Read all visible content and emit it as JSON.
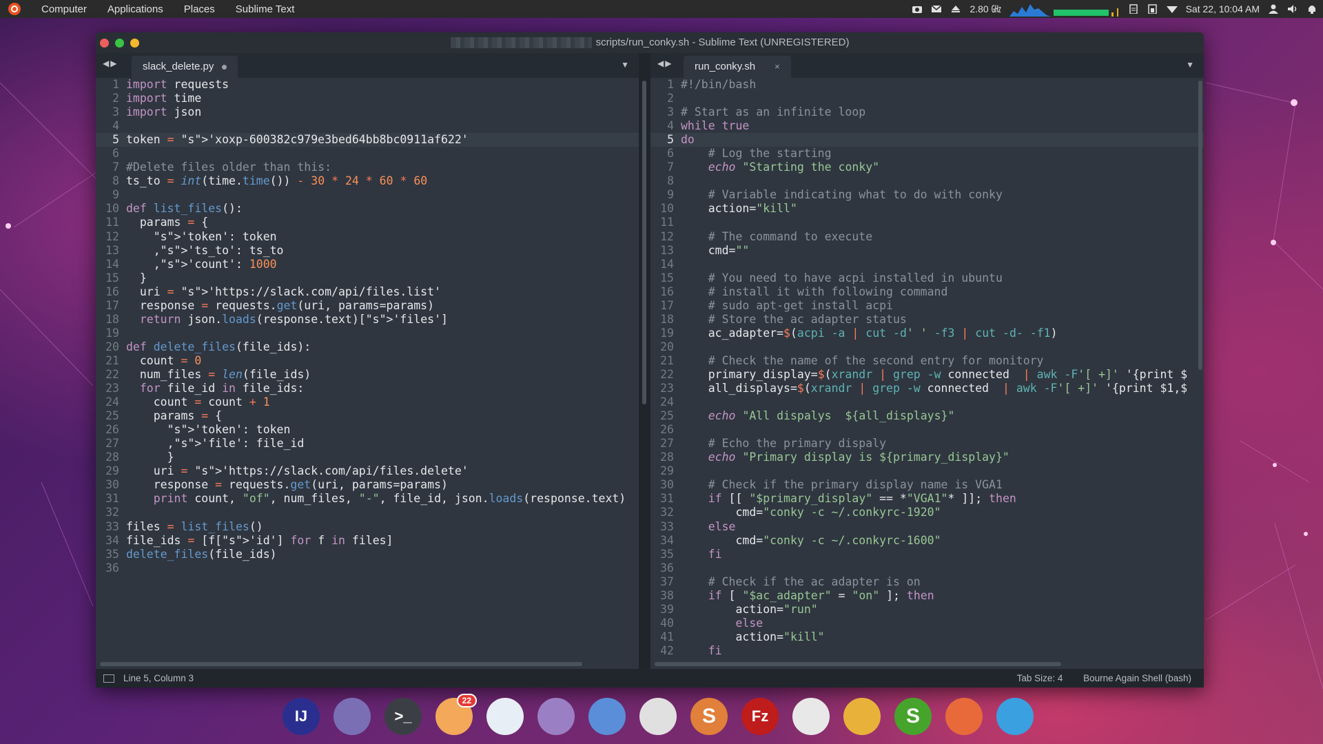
{
  "topbar": {
    "menus": [
      "Computer",
      "Applications",
      "Places",
      "Sublime Text"
    ],
    "cpu_freq": "2.80 ㎓",
    "datetime": "Sat 22, 10:04 AM"
  },
  "window": {
    "title": "scripts/run_conky.sh - Sublime Text (UNREGISTERED)"
  },
  "left_pane": {
    "tab_label": "slack_delete.py",
    "lines": [
      [
        "1",
        "import requests"
      ],
      [
        "2",
        "import time"
      ],
      [
        "3",
        "import json"
      ],
      [
        "4",
        ""
      ],
      [
        "5",
        "token = 'xoxp-600382c979e3bed64bb8bc0911af622'"
      ],
      [
        "6",
        ""
      ],
      [
        "7",
        "#Delete files older than this:"
      ],
      [
        "8",
        "ts_to = int(time.time()) - 30 * 24 * 60 * 60"
      ],
      [
        "9",
        ""
      ],
      [
        "10",
        "def list_files():"
      ],
      [
        "11",
        "  params = {"
      ],
      [
        "12",
        "    'token': token"
      ],
      [
        "13",
        "    ,'ts_to': ts_to"
      ],
      [
        "14",
        "    ,'count': 1000"
      ],
      [
        "15",
        "  }"
      ],
      [
        "16",
        "  uri = 'https://slack.com/api/files.list'"
      ],
      [
        "17",
        "  response = requests.get(uri, params=params)"
      ],
      [
        "18",
        "  return json.loads(response.text)['files']"
      ],
      [
        "19",
        ""
      ],
      [
        "20",
        "def delete_files(file_ids):"
      ],
      [
        "21",
        "  count = 0"
      ],
      [
        "22",
        "  num_files = len(file_ids)"
      ],
      [
        "23",
        "  for file_id in file_ids:"
      ],
      [
        "24",
        "    count = count + 1"
      ],
      [
        "25",
        "    params = {"
      ],
      [
        "26",
        "      'token': token"
      ],
      [
        "27",
        "      ,'file': file_id"
      ],
      [
        "28",
        "      }"
      ],
      [
        "29",
        "    uri = 'https://slack.com/api/files.delete'"
      ],
      [
        "30",
        "    response = requests.get(uri, params=params)"
      ],
      [
        "31",
        "    print count, \"of\", num_files, \"-\", file_id, json.loads(response.text)"
      ],
      [
        "32",
        ""
      ],
      [
        "33",
        "files = list_files()"
      ],
      [
        "34",
        "file_ids = [f['id'] for f in files]"
      ],
      [
        "35",
        "delete_files(file_ids)"
      ],
      [
        "36",
        ""
      ]
    ]
  },
  "right_pane": {
    "tab_label": "run_conky.sh",
    "tab_close": "×",
    "lines": [
      [
        "1",
        "#!/bin/bash"
      ],
      [
        "2",
        ""
      ],
      [
        "3",
        "# Start as an infinite loop"
      ],
      [
        "4",
        "while true"
      ],
      [
        "5",
        "do"
      ],
      [
        "6",
        "    # Log the starting"
      ],
      [
        "7",
        "    echo \"Starting the conky\""
      ],
      [
        "8",
        ""
      ],
      [
        "9",
        "    # Variable indicating what to do with conky"
      ],
      [
        "10",
        "    action=\"kill\""
      ],
      [
        "11",
        ""
      ],
      [
        "12",
        "    # The command to execute"
      ],
      [
        "13",
        "    cmd=\"\""
      ],
      [
        "14",
        ""
      ],
      [
        "15",
        "    # You need to have acpi installed in ubuntu"
      ],
      [
        "16",
        "    # install it with following command"
      ],
      [
        "17",
        "    # sudo apt-get install acpi"
      ],
      [
        "18",
        "    # Store the ac adapter status"
      ],
      [
        "19",
        "    ac_adapter=$(acpi -a | cut -d' ' -f3 | cut -d- -f1)"
      ],
      [
        "20",
        ""
      ],
      [
        "21",
        "    # Check the name of the second entry for monitory"
      ],
      [
        "22",
        "    primary_display=$(xrandr | grep -w connected  | awk -F'[ +]' '{print $"
      ],
      [
        "23",
        "    all_displays=$(xrandr | grep -w connected  | awk -F'[ +]' '{print $1,$"
      ],
      [
        "24",
        ""
      ],
      [
        "25",
        "    echo \"All dispalys  ${all_displays}\""
      ],
      [
        "26",
        ""
      ],
      [
        "27",
        "    # Echo the primary dispaly"
      ],
      [
        "28",
        "    echo \"Primary display is ${primary_display}\""
      ],
      [
        "29",
        ""
      ],
      [
        "30",
        "    # Check if the primary display name is VGA1"
      ],
      [
        "31",
        "    if [[ \"$primary_display\" == *\"VGA1\"* ]]; then"
      ],
      [
        "32",
        "        cmd=\"conky -c ~/.conkyrc-1920\""
      ],
      [
        "33",
        "    else"
      ],
      [
        "34",
        "        cmd=\"conky -c ~/.conkyrc-1600\""
      ],
      [
        "35",
        "    fi"
      ],
      [
        "36",
        ""
      ],
      [
        "37",
        "    # Check if the ac adapter is on"
      ],
      [
        "38",
        "    if [ \"$ac_adapter\" = \"on\" ]; then"
      ],
      [
        "39",
        "        action=\"run\""
      ],
      [
        "40",
        "        else"
      ],
      [
        "41",
        "        action=\"kill\""
      ],
      [
        "42",
        "    fi"
      ]
    ]
  },
  "statusbar": {
    "position": "Line 5, Column 3",
    "tab_size": "Tab Size: 4",
    "syntax": "Bourne Again Shell (bash)"
  },
  "dock": {
    "items": [
      {
        "name": "intellij-idea",
        "label": "IJ",
        "color": "#2a2f8f"
      },
      {
        "name": "files",
        "label": "",
        "color": "#7a6fb5"
      },
      {
        "name": "terminal",
        "label": ">_",
        "color": "#3b3f45"
      },
      {
        "name": "mail",
        "label": "",
        "color": "#f3a85a",
        "badge": "22"
      },
      {
        "name": "shutter",
        "label": "",
        "color": "#e8eef5"
      },
      {
        "name": "text-editor",
        "label": "",
        "color": "#9b7fc4"
      },
      {
        "name": "remote-desktop",
        "label": "",
        "color": "#5b8ed8"
      },
      {
        "name": "chrome",
        "label": "",
        "color": "#e0e0e0"
      },
      {
        "name": "sublime",
        "label": "S",
        "color": "#e0803a"
      },
      {
        "name": "filezilla",
        "label": "Fz",
        "color": "#bf1c1c"
      },
      {
        "name": "display-settings",
        "label": "",
        "color": "#e8e8e8"
      },
      {
        "name": "mysql-workbench",
        "label": "",
        "color": "#e8b23a"
      },
      {
        "name": "spreadsheet",
        "label": "S",
        "color": "#46a32b"
      },
      {
        "name": "inkscape-pen",
        "label": "",
        "color": "#e86a3a"
      },
      {
        "name": "telegram",
        "label": "",
        "color": "#3aa0e0"
      }
    ]
  }
}
